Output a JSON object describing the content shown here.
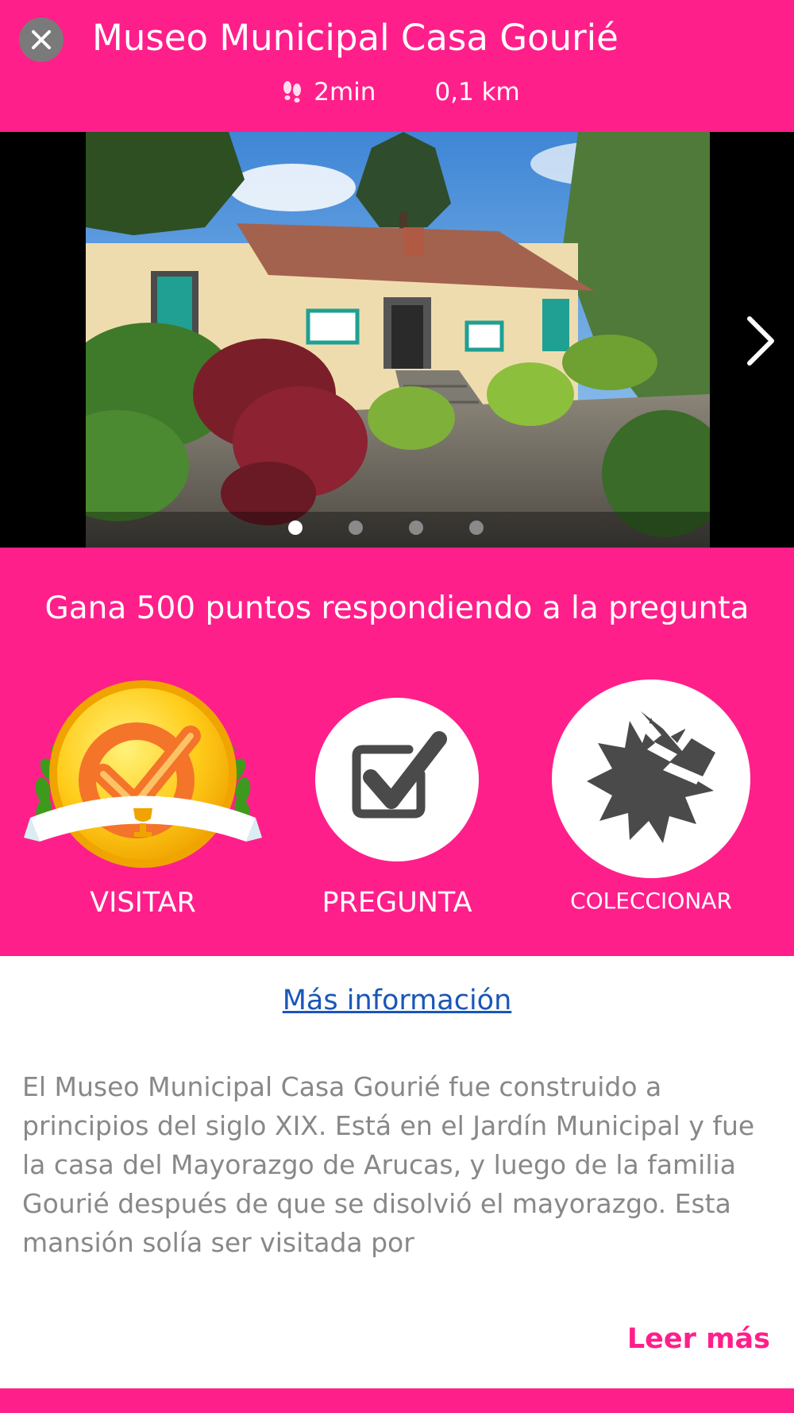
{
  "header": {
    "title": "Museo Municipal Casa Gourié",
    "walk_time": "2min",
    "distance": "0,1 km"
  },
  "gallery": {
    "image_count": 4,
    "active_index": 0
  },
  "promo": {
    "text": "Gana 500 puntos respondiendo a la pregunta"
  },
  "actions": [
    {
      "label": "VISITAR",
      "icon": "gold-checkmark-medal-icon"
    },
    {
      "label": "PREGUNTA",
      "icon": "checkbox-icon"
    },
    {
      "label": "COLECCIONAR",
      "icon": "torn-badge-icon"
    }
  ],
  "content": {
    "more_info_label": "Más información",
    "description": "El Museo Municipal Casa Gourié fue construido a principios del siglo XIX. Está en el Jardín Municipal y fue la casa del Mayorazgo de Arucas, y luego de la familia Gourié después de que se disolvió el mayorazgo. Esta mansión solía ser visitada por",
    "read_more_label": "Leer más"
  },
  "colors": {
    "accent": "#FF1F8A",
    "link": "#1957B8",
    "body_text": "#888888"
  }
}
